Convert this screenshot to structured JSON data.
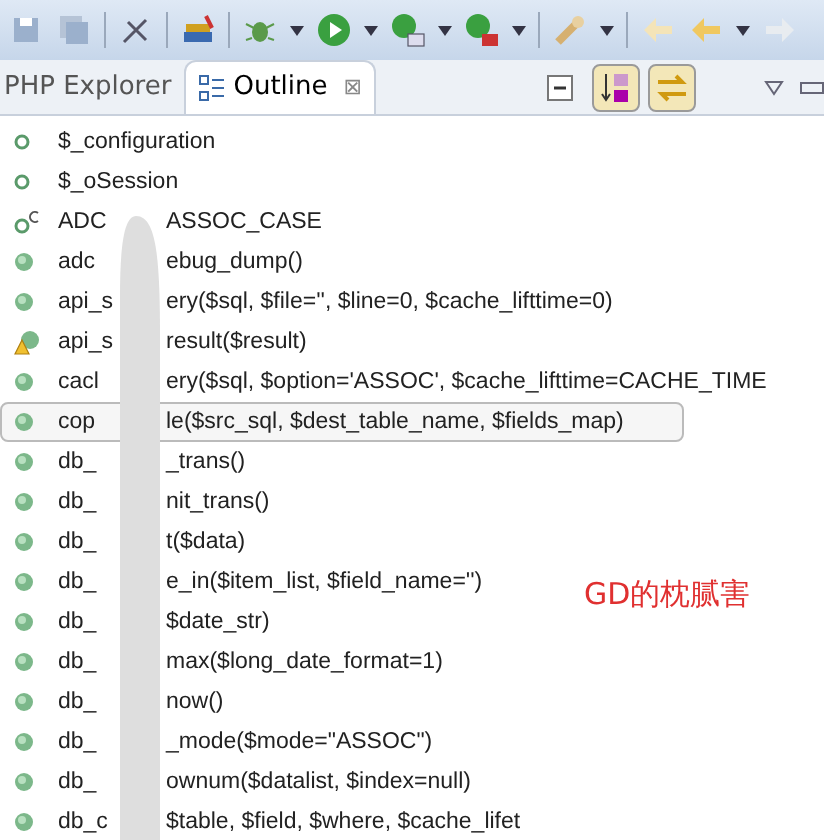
{
  "tabs": [
    {
      "label": "PHP Explorer",
      "selected": false,
      "closable": false
    },
    {
      "label": "Outline",
      "selected": true,
      "closable": true
    }
  ],
  "close_glyph": "⊠",
  "view_buttons": [
    {
      "kind": "collapse",
      "pressed": false
    },
    {
      "kind": "sort",
      "pressed": true
    },
    {
      "kind": "link",
      "pressed": true
    }
  ],
  "rows": [
    {
      "kind": "field",
      "prefix": "$_configuration",
      "suffix": "",
      "selected": false
    },
    {
      "kind": "field",
      "prefix": "$_oSession",
      "suffix": "",
      "selected": false
    },
    {
      "kind": "constant",
      "prefix": "ADC",
      "suffix": "ASSOC_CASE",
      "selected": false
    },
    {
      "kind": "function",
      "prefix": "adc",
      "suffix": "ebug_dump()",
      "selected": false
    },
    {
      "kind": "function",
      "prefix": "api_s",
      "suffix": "ery($sql, $file='', $line=0, $cache_lifttime=0)",
      "selected": false
    },
    {
      "kind": "warning",
      "prefix": "api_s",
      "suffix": "result($result)",
      "selected": false
    },
    {
      "kind": "function",
      "prefix": "cacl",
      "suffix": "ery($sql, $option='ASSOC', $cache_lifttime=CACHE_TIME",
      "selected": false
    },
    {
      "kind": "function",
      "prefix": "cop",
      "suffix": "le($src_sql, $dest_table_name, $fields_map)",
      "selected": true
    },
    {
      "kind": "function",
      "prefix": "db_",
      "suffix": "_trans()",
      "selected": false
    },
    {
      "kind": "function",
      "prefix": "db_",
      "suffix": "nit_trans()",
      "selected": false
    },
    {
      "kind": "function",
      "prefix": "db_",
      "suffix": "t($data)",
      "selected": false
    },
    {
      "kind": "function",
      "prefix": "db_",
      "suffix": "e_in($item_list, $field_name='')",
      "selected": false
    },
    {
      "kind": "function",
      "prefix": "db_",
      "suffix": "$date_str)",
      "selected": false
    },
    {
      "kind": "function",
      "prefix": "db_",
      "suffix": "max($long_date_format=1)",
      "selected": false
    },
    {
      "kind": "function",
      "prefix": "db_",
      "suffix": "now()",
      "selected": false
    },
    {
      "kind": "function",
      "prefix": "db_",
      "suffix": "_mode($mode=\"ASSOC\")",
      "selected": false
    },
    {
      "kind": "function",
      "prefix": "db_",
      "suffix": "ownum($datalist, $index=null)",
      "selected": false
    },
    {
      "kind": "function",
      "prefix": "db_c",
      "suffix": "$table, $field, $where, $cache_lifet",
      "selected": false
    }
  ],
  "annotation": "GD的枕腻害"
}
